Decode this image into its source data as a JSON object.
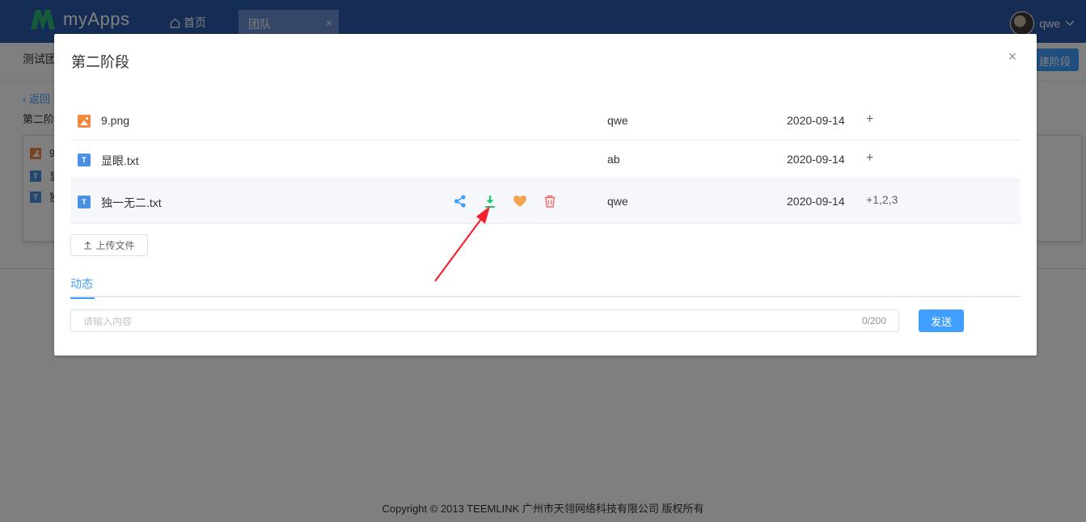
{
  "app": {
    "name": "myApps"
  },
  "topnav": {
    "home_label": "首页",
    "tab_label": "团队",
    "tab_close": "×",
    "username": "qwe"
  },
  "subbar": {
    "team_name": "测试团",
    "new_stage_label": "建阶段"
  },
  "page": {
    "back_label": "返回",
    "stage_title": "第二阶",
    "mini_files": [
      "9",
      "显",
      "独"
    ]
  },
  "dialog": {
    "title": "第二阶段",
    "close_label": "×",
    "files": [
      {
        "icon": "image-file-icon",
        "name": "9.png",
        "owner": "qwe",
        "date": "2020-09-14",
        "tags": "+"
      },
      {
        "icon": "text-file-icon",
        "name": "显眼.txt",
        "owner": "ab",
        "date": "2020-09-14",
        "tags": "+"
      },
      {
        "icon": "text-file-icon",
        "name": "独一无二.txt",
        "owner": "qwe",
        "date": "2020-09-14",
        "tags": "+1,2,3"
      }
    ],
    "upload_label": "上传文件",
    "tab_label": "动态",
    "comment": {
      "placeholder": "请输入内容",
      "counter": "0/200"
    },
    "send_label": "发送"
  },
  "footer": {
    "text": "Copyright © 2013 TEEMLINK 广州市天翎网络科技有限公司 版权所有"
  },
  "colors": {
    "primary": "#409eff",
    "topbar": "#2b5aa8",
    "share": "#409eff",
    "download": "#13ce66",
    "favorite": "#f5a04a",
    "delete": "#f56c6c",
    "annotation": "#f5222d"
  }
}
